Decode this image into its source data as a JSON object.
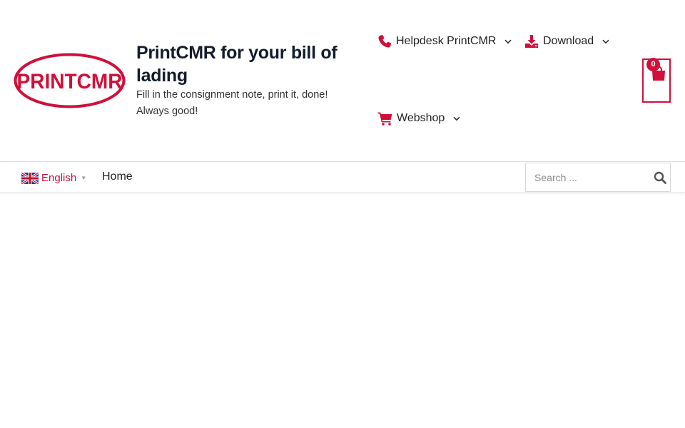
{
  "site": {
    "logo_text": "PRINTCMR",
    "title": "PrintCMR for your bill of lading",
    "tagline": "Fill in the consignment note, print it, done! Always good!"
  },
  "top_menu": {
    "helpdesk": {
      "label": "Helpdesk PrintCMR",
      "icon": "phone-icon"
    },
    "download": {
      "label": "Download",
      "icon": "download-icon"
    },
    "webshop": {
      "label": "Webshop",
      "icon": "cart-icon"
    }
  },
  "cart": {
    "count": "0",
    "icon": "shopping-bag-icon"
  },
  "nav": {
    "language": {
      "label": "English",
      "flag": "uk-flag-icon"
    },
    "home_label": "Home"
  },
  "search": {
    "placeholder": "Search ...",
    "value": ""
  },
  "colors": {
    "brand": "#d0103a",
    "title": "#141c2b"
  }
}
